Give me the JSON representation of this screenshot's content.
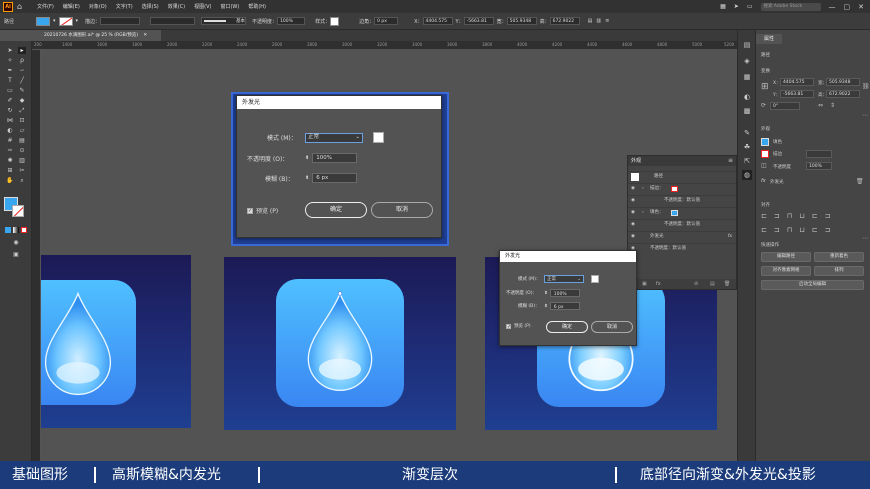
{
  "app": {
    "logo": "Ai"
  },
  "menu": [
    "文件(F)",
    "编辑(E)",
    "对象(O)",
    "文字(T)",
    "选择(S)",
    "效果(C)",
    "视图(V)",
    "窗口(W)",
    "帮助(H)"
  ],
  "menu_search": "搜索 Adobe Stock",
  "control_bar": {
    "stroke_label": "描边：",
    "stroke_style": "基本",
    "opacity_label": "不透明度：",
    "opacity_value": "100%",
    "style_label": "样式：",
    "corner_label": "边角：",
    "corner_value": "0 px",
    "x_label": "X：",
    "x_value": "4404.575",
    "y_label": "Y：",
    "y_value": "-5663.81",
    "w_label": "宽：",
    "w_value": "505.9348",
    "h_label": "高：",
    "h_value": "672.9022",
    "fill_color": "#39a7ef"
  },
  "document_tab": "20210726 水滴图形.ai* @ 25 % (RGB/预览)",
  "ruler_ticks": [
    "200",
    "1400",
    "1600",
    "1800",
    "2000",
    "2200",
    "2400",
    "2600",
    "2800",
    "3000",
    "3200",
    "3400",
    "3600",
    "3800",
    "4000",
    "4200",
    "4400",
    "4600",
    "4800",
    "5000",
    "5200"
  ],
  "dialog_large": {
    "title": "外发光",
    "mode_label": "模式 (M)：",
    "mode_value": "正常",
    "opacity_label": "不透明度 (O)：",
    "opacity_value": "100%",
    "blur_label": "模糊 (B)：",
    "blur_value": "6 px",
    "preview_label": "预览 (P)",
    "ok": "确定",
    "cancel": "取消"
  },
  "dialog_small": {
    "title": "外发光",
    "mode_label": "模式 (M)：",
    "mode_value": "正常",
    "opacity_label": "不透明度 (O)：",
    "opacity_value": "100%",
    "blur_label": "模糊 (B)：",
    "blur_value": "6 px",
    "preview_label": "预览 (P)",
    "ok": "确定",
    "cancel": "取消"
  },
  "appearance_panel": {
    "title": "外观",
    "rows": [
      {
        "label": "路径"
      },
      {
        "label": "描边："
      },
      {
        "label": "不透明度：默认值"
      },
      {
        "label": "填色："
      },
      {
        "label": "不透明度：默认值"
      },
      {
        "label": "外发光",
        "fx": "fx"
      },
      {
        "label": "不透明度：默认值"
      }
    ]
  },
  "properties_panel": {
    "tab": "属性",
    "section_path": "路径",
    "section_transform": "变换",
    "x_label": "X：",
    "x_value": "4404.575",
    "y_label": "Y：",
    "y_value": "-5663.81",
    "w_label": "宽：",
    "w_value": "505.9348",
    "h_label": "高：",
    "h_value": "672.9022",
    "angle_value": "0°",
    "section_appearance": "外观",
    "fill_label": "填色",
    "stroke_label": "描边",
    "opacity_label": "不透明度",
    "opacity_value": "100%",
    "fx_label": "外发光",
    "section_align": "对齐",
    "section_quick": "快速操作",
    "btn_edit_path": "编辑路径",
    "btn_recolor": "重新着色",
    "btn_align_pixel": "对齐像素网格",
    "btn_arrange": "排列",
    "btn_global_edit": "启动全局编辑"
  },
  "banner": {
    "caption_1": "基础图形",
    "caption_2": "高斯模糊&内发光",
    "caption_3": "渐变层次",
    "caption_4": "底部径向渐变&外发光&投影"
  }
}
